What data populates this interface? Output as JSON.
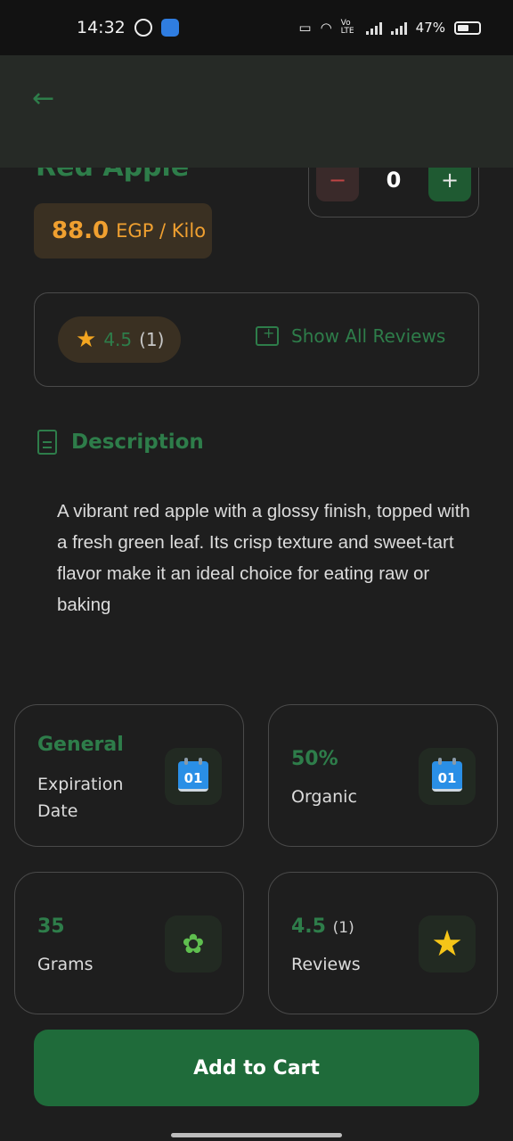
{
  "status_bar": {
    "time": "14:32",
    "net_label": "Vo LTE",
    "battery": "47%"
  },
  "product": {
    "name": "Red Apple",
    "price_value": "88.0",
    "price_unit": "EGP / Kilo",
    "quantity": "0",
    "minus_label": "−",
    "plus_label": "+"
  },
  "rating": {
    "value": "4.5",
    "count": "(1)",
    "show_all_label": "Show All Reviews"
  },
  "description": {
    "title": "Description",
    "text": "A vibrant red apple with a glossy finish, topped with a fresh green leaf. Its crisp texture and sweet-tart flavor make it an ideal choice for eating raw or baking"
  },
  "cards": [
    {
      "top": "General",
      "label": "Expiration Date",
      "icon": "calendar-icon",
      "icon_text": "01"
    },
    {
      "top": "50%",
      "label": "Organic",
      "icon": "calendar-icon",
      "icon_text": "01"
    },
    {
      "top": "35",
      "label": "Grams",
      "icon": "plant-hand-icon"
    },
    {
      "top": "4.5",
      "top_sub": "(1)",
      "label": "Reviews",
      "icon": "star-icon"
    }
  ],
  "add_to_cart_label": "Add to Cart",
  "colors": {
    "accent_green": "#2e7d4a",
    "price_orange": "#f0a030",
    "button_green": "#1f6b3a",
    "background": "#1e1e1e"
  }
}
